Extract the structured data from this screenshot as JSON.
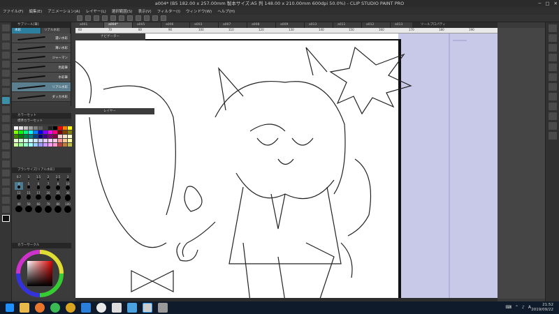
{
  "window": {
    "title": "a004* (B5 182.00 x 257.00mm 製本サイズ:A5 判 148.00 x 210.00mm 600dpi 50.0%) - CLIP STUDIO PAINT PRO",
    "min": "─",
    "max": "□",
    "close": "✕"
  },
  "menu": [
    "ファイル(F)",
    "編集(E)",
    "アニメーション(A)",
    "レイヤー(L)",
    "選択範囲(S)",
    "表示(V)",
    "フィルター(I)",
    "ウィンドウ(W)",
    "ヘルプ(H)"
  ],
  "tabs": [
    {
      "label": "a001",
      "active": false
    },
    {
      "label": "a004*",
      "active": true
    },
    {
      "label": "a005",
      "active": false
    },
    {
      "label": "a006",
      "active": false
    },
    {
      "label": "a003",
      "active": false
    },
    {
      "label": "a007",
      "active": false
    },
    {
      "label": "a008",
      "active": false
    },
    {
      "label": "a009",
      "active": false
    },
    {
      "label": "a013",
      "active": false
    },
    {
      "label": "a011",
      "active": false
    },
    {
      "label": "a012",
      "active": false
    },
    {
      "label": "a013",
      "active": false
    }
  ],
  "ruler": [
    "60",
    "70",
    "80",
    "90",
    "100",
    "110",
    "120",
    "130",
    "140",
    "150",
    "160",
    "170",
    "180",
    "190"
  ],
  "panels": {
    "subtool_title": "サブツール[筆]",
    "subtool_tabs": [
      "水彩",
      "リアル水彩"
    ],
    "brushes": [
      {
        "label": "濃い水彩",
        "on": false
      },
      {
        "label": "薄い水彩",
        "on": false
      },
      {
        "label": "ジャーマン",
        "on": false
      },
      {
        "label": "色鉛筆",
        "on": false
      },
      {
        "label": "水彩筆",
        "on": false
      },
      {
        "label": "リアル水彩",
        "on": true
      },
      {
        "label": "ダッカ水彩",
        "on": false
      }
    ],
    "colorset_title": "カラーセット",
    "colorset_name": "標準カラーセット",
    "brushsize_title": "ブラシサイズ[リアル水彩]",
    "sizes": [
      "0.7",
      "1",
      "1.5",
      "2",
      "2.5",
      "3",
      "4",
      "5",
      "6",
      "7",
      "8",
      "10",
      "12",
      "15",
      "17",
      "20",
      "25",
      "30",
      "40",
      "50",
      "60",
      "70",
      "80",
      "100"
    ],
    "colorwheel_title": "カラーサークル",
    "navigator_title": "ナビゲーター",
    "layer_title": "レイヤー",
    "tool_property_title": "ツールプロパティ"
  },
  "taskbar": {
    "time": "21:52",
    "date": "2019/09/22",
    "lang": "A"
  },
  "colors": {
    "accent": "#2d7fa0",
    "canvas_bg": "#c8c8e8",
    "paper": "#ffffff"
  }
}
